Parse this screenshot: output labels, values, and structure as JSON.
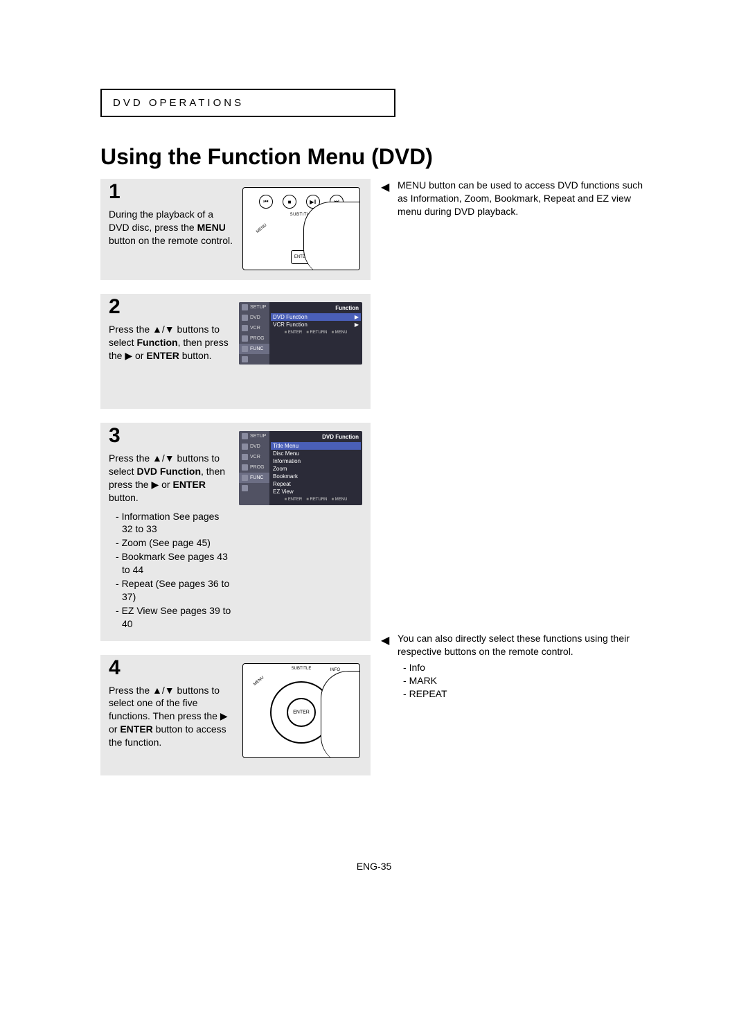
{
  "section_label": "DVD OPERATIONS",
  "title": "Using the Function Menu (DVD)",
  "page_number": "ENG-35",
  "steps": {
    "s1": {
      "num": "1",
      "text_a": "During the playback of a DVD disc, press the ",
      "text_bold": "MENU",
      "text_b": " button on the remote control."
    },
    "s2": {
      "num": "2",
      "text_a": "Press the ▲/▼ buttons to select ",
      "text_bold": "Function",
      "text_b": ", then press the ▶ or ",
      "text_bold2": "ENTER",
      "text_c": " button."
    },
    "s3": {
      "num": "3",
      "text_a": "Press the ▲/▼ buttons to select ",
      "text_bold": "DVD Function",
      "text_b": ", then press the ▶ or ",
      "text_bold2": "ENTER",
      "text_c": " button.",
      "items": [
        "Information See pages 32 to 33",
        "Zoom (See page 45)",
        "Bookmark See pages 43 to 44",
        "Repeat (See pages 36 to 37)",
        "EZ View See pages 39 to 40"
      ]
    },
    "s4": {
      "num": "4",
      "text_a": "Press the ▲/▼ buttons to select one of the five functions. Then press the ▶ or ",
      "text_bold": "ENTER",
      "text_b": " button to access the function."
    }
  },
  "osd": {
    "side": [
      "SETUP",
      "DVD",
      "VCR",
      "PROG",
      "FUNC"
    ],
    "footer": [
      "ENTER",
      "RETURN",
      "MENU"
    ],
    "screen2": {
      "title": "Function",
      "rows": [
        "DVD Function",
        "VCR Function"
      ]
    },
    "screen3": {
      "title": "DVD Function",
      "rows": [
        "Title Menu",
        "Disc Menu",
        "Information",
        "Zoom",
        "Bookmark",
        "Repeat",
        "EZ View"
      ]
    }
  },
  "remote": {
    "subtitle": "SUBTITLE",
    "menu": "MENU",
    "enter": "ENTER",
    "info": "INFO"
  },
  "notes": {
    "n1": "MENU button can be used to access DVD functions such as Information, Zoom, Bookmark, Repeat and EZ view menu during DVD playback.",
    "n2_text": "You can also directly select these functions using their respective buttons on the remote control.",
    "n2_items": [
      "Info",
      "MARK",
      "REPEAT"
    ]
  }
}
